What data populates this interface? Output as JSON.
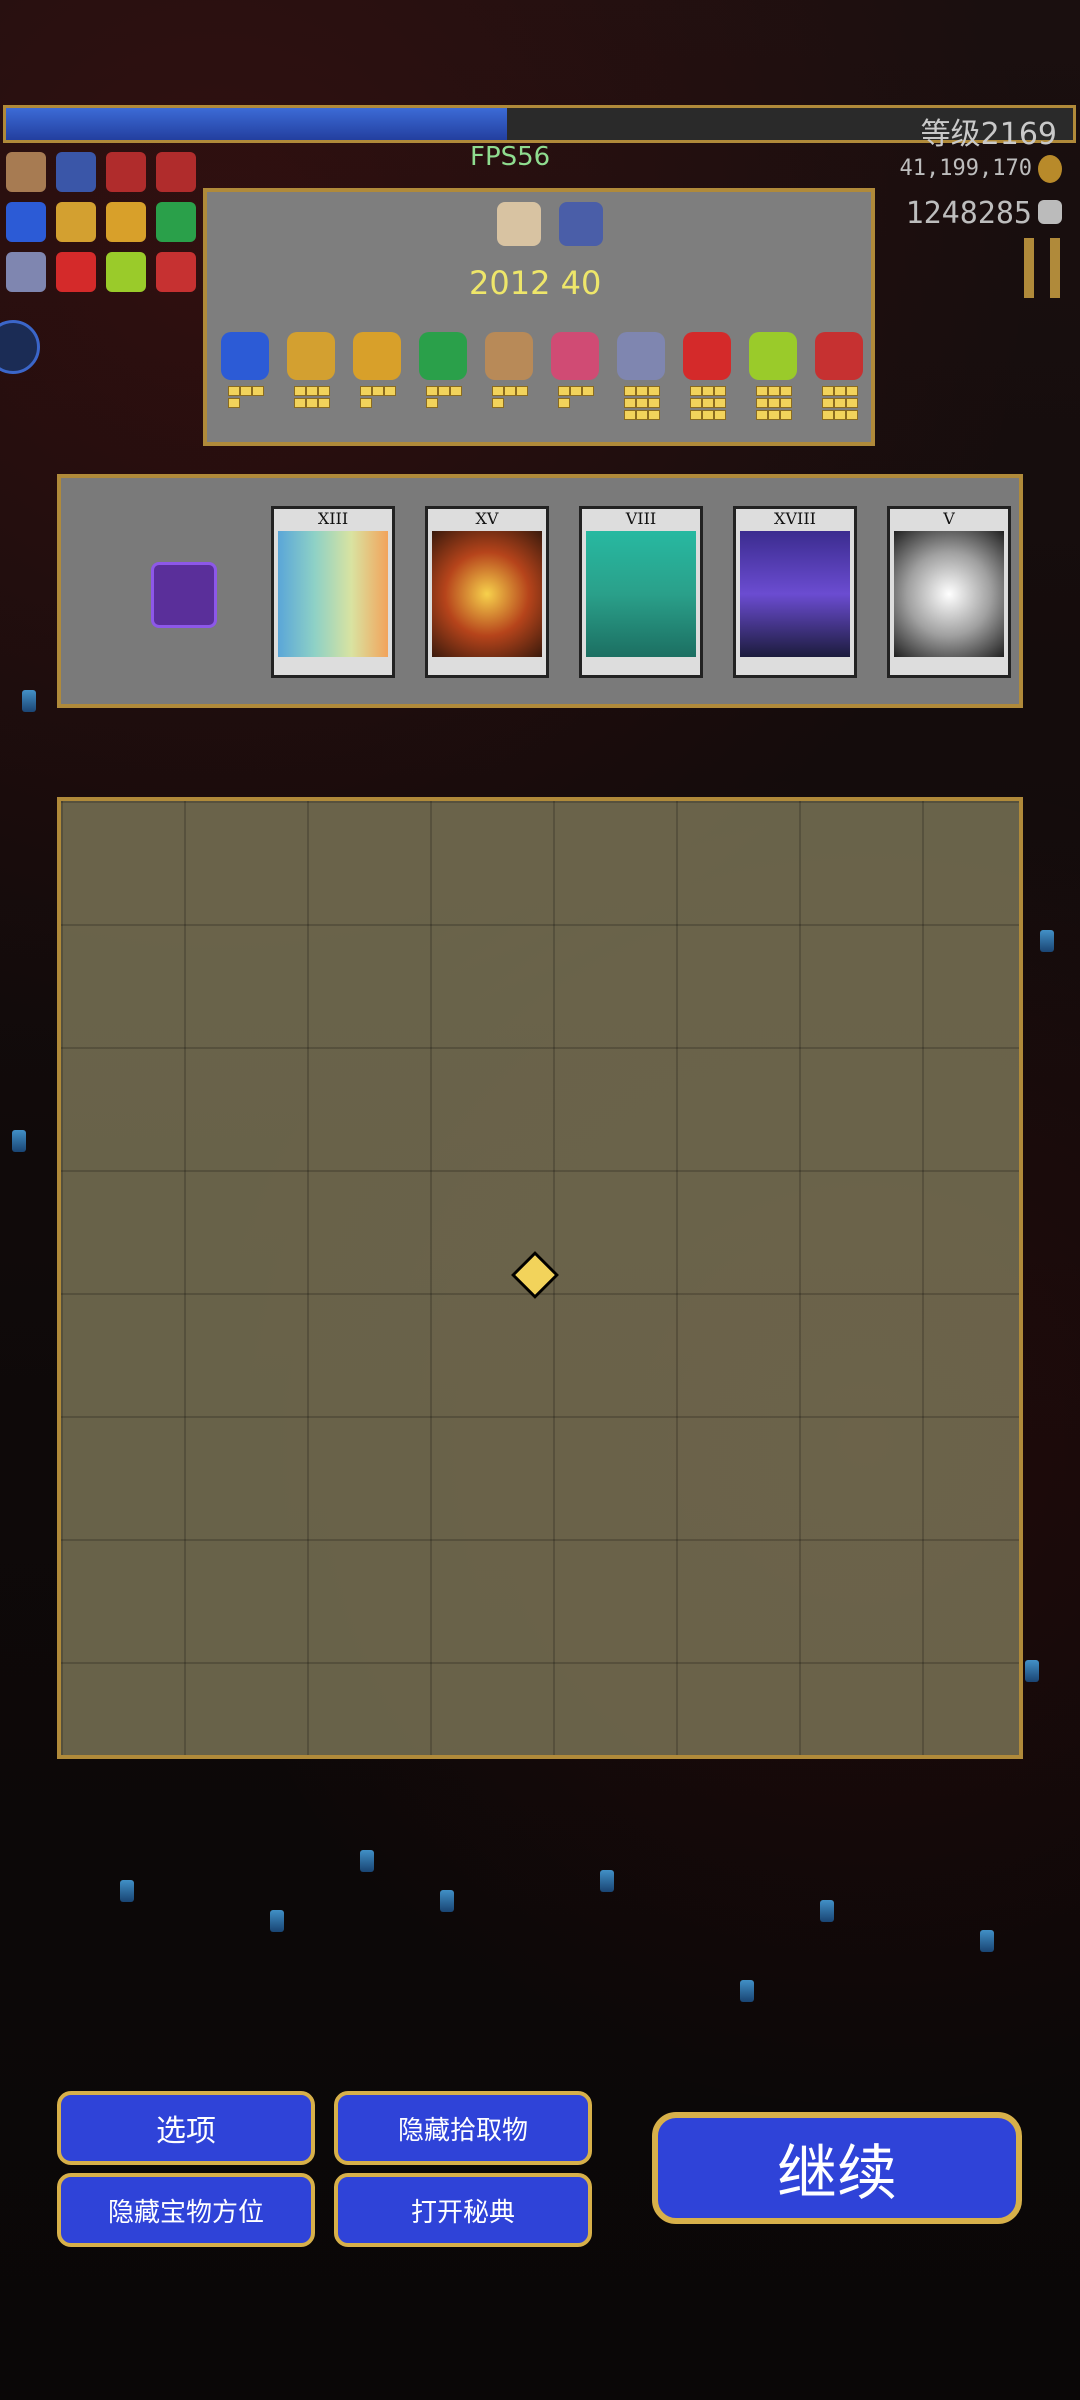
{
  "hud": {
    "level_label": "等级2169",
    "fps": "FPS56",
    "gold": "41,199,170",
    "kills": "1248285"
  },
  "popup": {
    "counts": "2012 40",
    "top_icons": [
      "bag-icon",
      "ring-icon"
    ],
    "items": [
      {
        "icon": "blue-orb-icon",
        "color": "#2c5bd6"
      },
      {
        "icon": "gold-bar-icon",
        "color": "#d3a030"
      },
      {
        "icon": "crown-icon",
        "color": "#d8a02a"
      },
      {
        "icon": "clover-icon",
        "color": "#2aa04a"
      },
      {
        "icon": "mask-icon",
        "color": "#b88a58"
      },
      {
        "icon": "skull-icon",
        "color": "#d04b74"
      },
      {
        "icon": "silver-ring-icon",
        "color": "#7f86b0"
      },
      {
        "icon": "red-arrow-icon",
        "color": "#d42a2a"
      },
      {
        "icon": "gold-ring-icon",
        "color": "#9acb2a"
      },
      {
        "icon": "red-cross-icon",
        "color": "#c63131"
      }
    ]
  },
  "tarot": {
    "cards": [
      {
        "numeral": "XIII",
        "art": "linear-gradient(90deg,#5aa6d8,#8ed1c6,#d9e3a1,#f2a35b)"
      },
      {
        "numeral": "XV",
        "art": "radial-gradient(circle,#f7d14c,#b6441b,#3a1a0c)"
      },
      {
        "numeral": "VIII",
        "art": "linear-gradient(180deg,#27b9a1,#2aa08a,#1c6f62)"
      },
      {
        "numeral": "XVIII",
        "art": "linear-gradient(180deg,#3b2c8f,#6b4cd1,#1c1c3d)"
      },
      {
        "numeral": "V",
        "art": "radial-gradient(circle,#ffffff,#a0a0a0,#202020)"
      }
    ]
  },
  "buttons": {
    "options": "选项",
    "hide_pickups": "隐藏拾取物",
    "hide_treasure": "隐藏宝物方位",
    "open_codex": "打开秘典",
    "continue": "继续"
  }
}
